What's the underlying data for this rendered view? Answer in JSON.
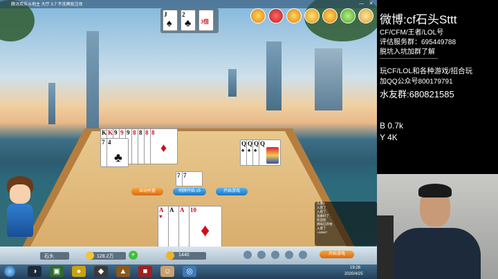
{
  "window": {
    "title": "腾讯欢乐斗地主 大厅 3.7 不洗牌底注场",
    "minimize": "—",
    "close": "✕"
  },
  "top_cards": [
    {
      "rank": "J",
      "suit": "♠",
      "color": "#111111"
    },
    {
      "rank": "2",
      "suit": "♣",
      "color": "#111111"
    },
    {
      "rank": "3倍",
      "suit": "",
      "color": "#d10c1c"
    }
  ],
  "left_player_cards": {
    "ranks": [
      "K",
      "K",
      "9",
      "9",
      "9",
      "8",
      "8",
      "8",
      "8"
    ],
    "second_row": [
      "7",
      "4"
    ],
    "suit_display": "♦",
    "lower_suit": "♣"
  },
  "right_player_cards": {
    "ranks": [
      "Q",
      "Q",
      "Q",
      "Q"
    ],
    "suit": "♠"
  },
  "center_played": {
    "ranks": [
      "7",
      "7"
    ]
  },
  "hand_cards": {
    "ranks": [
      "A",
      "A",
      "A",
      "10"
    ],
    "suit": "♥",
    "big_suit": "♦"
  },
  "buttons": {
    "left": "自动托管",
    "middle": "明牌开始 x5",
    "right": "开始游戏"
  },
  "bottom_bar": {
    "player_name": "石头",
    "beans": "128.2万",
    "gold": "1440",
    "right_button": "开始游戏"
  },
  "chat": {
    "lines": [
      "头像3",
      "入座了",
      "入座了",
      "准备好了",
      "欢迎您",
      "牌局已开始",
      "入座了",
      "+44847"
    ]
  },
  "taskbar": {
    "time": "19:28",
    "date": "2020/4/25"
  },
  "overlay": {
    "line1": "微博:cf石头Sttt",
    "line2": "CF/CFM/王者/LOL号",
    "line3": "评估服务群：695449788",
    "line4": "脱坑入坑加群了解",
    "separator": "------------------------------------",
    "line5": "玩CF/LOL和各种游戏/招合玩",
    "line6": "加QQ公众号800179791",
    "line7": "水友群:680821585",
    "stat_b": "B 0.7k",
    "stat_y": "Y 4K"
  },
  "colors": {
    "red_suit": "#d10c1c",
    "black_suit": "#111111",
    "button_orange": "#e2801c",
    "button_blue": "#2a8fd8"
  }
}
